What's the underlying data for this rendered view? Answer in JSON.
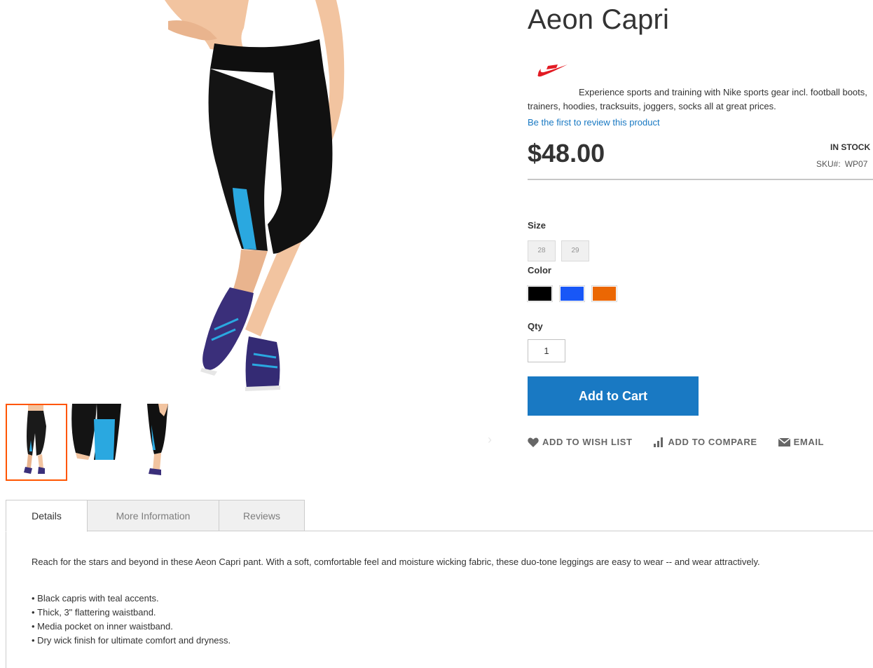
{
  "product": {
    "title": "Aeon Capri",
    "brand_description": "Experience sports and training with Nike sports gear incl. football boots, trainers, hoodies, tracksuits, joggers, socks all at great prices.",
    "review_link": "Be the first to review this product",
    "price": "$48.00",
    "stock": "IN STOCK",
    "sku_label": "SKU#:",
    "sku_value": "WP07"
  },
  "options": {
    "size_label": "Size",
    "sizes": [
      "28",
      "29"
    ],
    "color_label": "Color",
    "colors": [
      {
        "name": "Black",
        "hex": "#000000"
      },
      {
        "name": "Blue",
        "hex": "#1857f7"
      },
      {
        "name": "Orange",
        "hex": "#eb6703"
      }
    ],
    "qty_label": "Qty",
    "qty_value": "1"
  },
  "actions": {
    "add_to_cart": "Add to Cart",
    "wishlist": "ADD TO WISH LIST",
    "compare": "ADD TO COMPARE",
    "email": "EMAIL"
  },
  "tabs": [
    {
      "label": "Details"
    },
    {
      "label": "More Information"
    },
    {
      "label": "Reviews"
    }
  ],
  "details": {
    "paragraph": "Reach for the stars and beyond in these Aeon Capri pant. With a soft, comfortable feel and moisture wicking fabric, these duo-tone leggings are easy to wear -- and wear attractively.",
    "bullets": [
      "Black capris with teal accents.",
      "Thick, 3\" flattering waistband.",
      "Media pocket on inner waistband.",
      "Dry wick finish for ultimate comfort and dryness."
    ]
  },
  "colors": {
    "accent": "#1979c3",
    "thumb_active_border": "#ff5501",
    "brand_red": "#e21b23"
  },
  "icons": {
    "brand": "nike-swoosh-icon",
    "wishlist": "heart-icon",
    "compare": "bar-chart-icon",
    "email": "envelope-icon",
    "gallery_next": "chevron-right-icon"
  }
}
